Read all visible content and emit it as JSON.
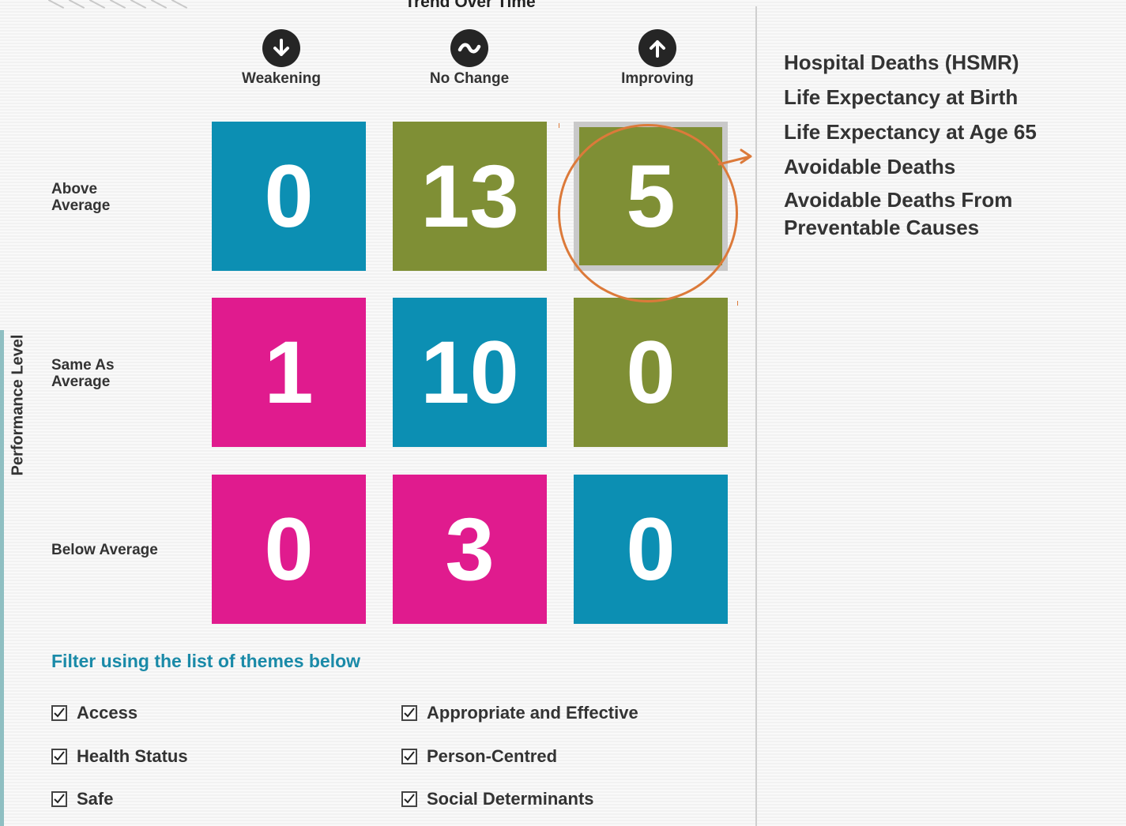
{
  "header": {
    "title": "Trend Over Time"
  },
  "columns": [
    {
      "label": "Weakening",
      "icon": "arrow-down-icon"
    },
    {
      "label": "No Change",
      "icon": "tilde-icon"
    },
    {
      "label": "Improving",
      "icon": "arrow-up-icon"
    }
  ],
  "rows": [
    {
      "label_line1": "Above",
      "label_line2": "Average"
    },
    {
      "label_line1": "Same As",
      "label_line2": "Average"
    },
    {
      "label_line1": "Below Average",
      "label_line2": ""
    }
  ],
  "y_axis_label": "Performance Level",
  "matrix": [
    [
      "0",
      "13",
      "5"
    ],
    [
      "1",
      "10",
      "0"
    ],
    [
      "0",
      "3",
      "0"
    ]
  ],
  "colors": {
    "blue": "#0c8fb3",
    "olive": "#7f8f35",
    "pink": "#e01b8e",
    "accent_orange": "#dc7a3a",
    "filter_title": "#1a8aa8"
  },
  "tile_colors": [
    [
      "blue",
      "olive",
      "olive"
    ],
    [
      "pink",
      "blue",
      "olive"
    ],
    [
      "pink",
      "pink",
      "blue"
    ]
  ],
  "selected_tile": "Above Average / Improving",
  "indicators": [
    "Hospital Deaths (HSMR)",
    "Life Expectancy at Birth",
    "Life Expectancy at Age 65",
    "Avoidable Deaths",
    "Avoidable Deaths From Preventable Causes"
  ],
  "indicator_last_lines": [
    "Avoidable Deaths From",
    "Preventable Causes"
  ],
  "filter": {
    "title": "Filter using the list of themes below",
    "themes": [
      {
        "label": "Access",
        "checked": true
      },
      {
        "label": "Appropriate and Effective",
        "checked": true
      },
      {
        "label": "Health Status",
        "checked": true
      },
      {
        "label": "Person-Centred",
        "checked": true
      },
      {
        "label": "Safe",
        "checked": true
      },
      {
        "label": "Social Determinants",
        "checked": true
      }
    ]
  }
}
